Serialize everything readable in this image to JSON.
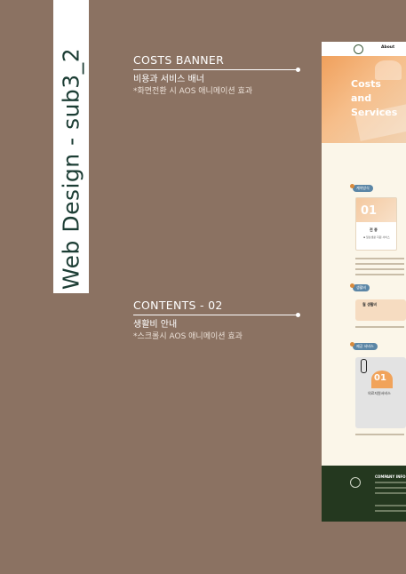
{
  "side_title": "Web Design - sub3_2",
  "notes": [
    {
      "heading": "COSTS BANNER",
      "desc": "비용과 서비스 배너",
      "detail": "*화면전환 시 AOS 애니메이션 효과"
    },
    {
      "heading": "CONTENTS - 02",
      "desc": "생활비 안내",
      "detail": "*스크롤시 AOS 애니메이션 효과"
    }
  ],
  "preview": {
    "nav_item": "About",
    "hero_lines": [
      "Costs",
      "and",
      "Services"
    ],
    "section_tags": [
      "계약방식",
      "생활비",
      "제공 서비스"
    ],
    "card1_num": "01",
    "card1_title": "전 종",
    "card1_text": "▪ 일상생활 지원 서비스",
    "bar2_title": "월 생활비",
    "card3_num": "01",
    "card3_title": "의료지원서비스",
    "footer_title": "COMPANY INFO"
  },
  "colors": {
    "background": "#8b7262",
    "title_text": "#1c3d34",
    "footer": "#24381f",
    "hero": "#f0a05c"
  }
}
